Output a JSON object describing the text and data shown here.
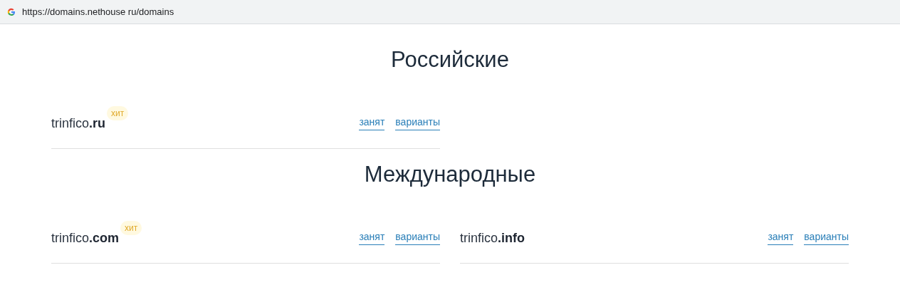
{
  "address_bar": {
    "url": "https://domains.nethouse ru/domains"
  },
  "sections": [
    {
      "title": "Российские",
      "domains": [
        {
          "name": "trinfico**.ru**",
          "badge": "хит",
          "links": [
            "занят",
            "варианты"
          ]
        }
      ]
    },
    {
      "title": "Международные",
      "domains": [
        {
          "name": "trinfico**.com**",
          "badge": "хит",
          "links": [
            "занят",
            "варианты"
          ]
        },
        {
          "name": "trinfico**.info**",
          "links": [
            "занят",
            "варианты"
          ]
        }
      ]
    }
  ]
}
